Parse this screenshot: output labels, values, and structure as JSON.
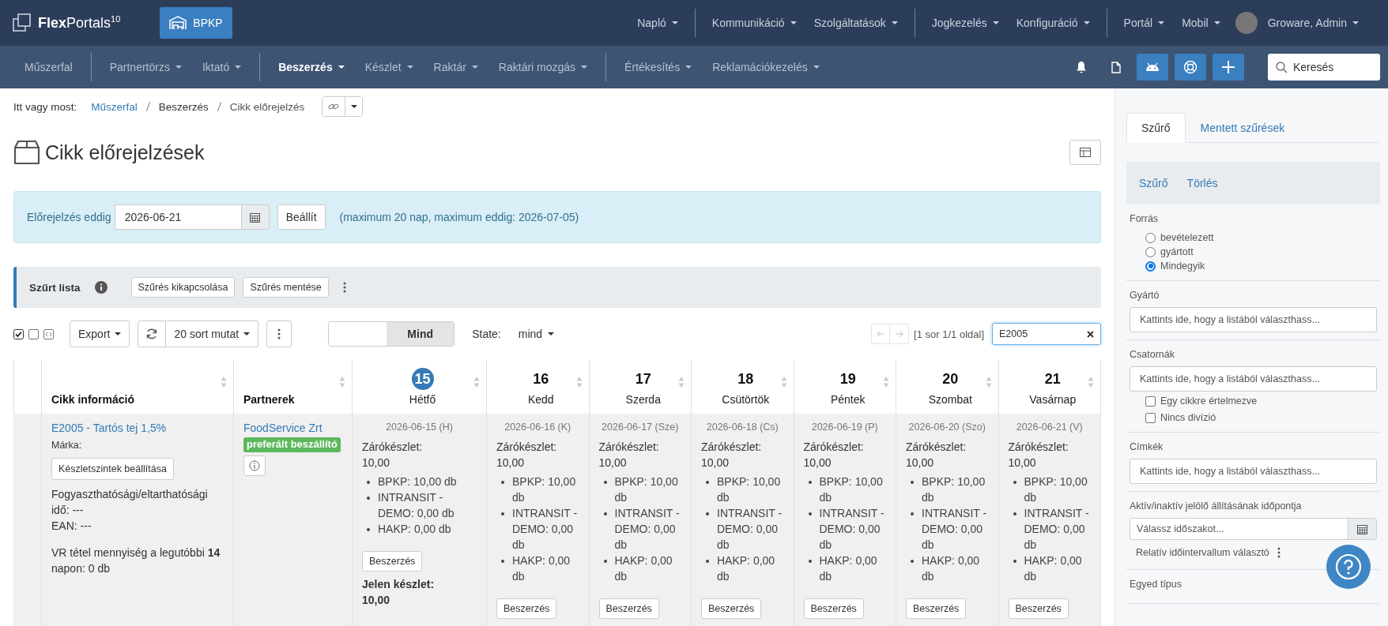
{
  "header": {
    "logo": "**Flex**Portals$^{10}$",
    "site_button": "BPKP",
    "menu_groups": [
      {
        "items": [
          {
            "label": "Napló"
          }
        ]
      },
      {
        "items": [
          {
            "label": "Kommunikáció"
          },
          {
            "label": "Szolgáltatások"
          }
        ]
      },
      {
        "items": [
          {
            "label": "Jogkezelés"
          },
          {
            "label": "Konfiguráció"
          }
        ]
      },
      {
        "items": [
          {
            "label": "Portál"
          },
          {
            "label": "Mobil"
          }
        ]
      }
    ],
    "user": "Groware, Admin"
  },
  "nav": {
    "groups": [
      {
        "items": [
          {
            "label": "Műszerfal",
            "dropdown": false,
            "selected": false
          }
        ]
      },
      {
        "items": [
          {
            "label": "Partnertörzs",
            "dropdown": true,
            "selected": false
          },
          {
            "label": "Iktató",
            "dropdown": true,
            "selected": false
          }
        ]
      },
      {
        "items": [
          {
            "label": "Beszerzés",
            "dropdown": true,
            "selected": true
          },
          {
            "label": "Készlet",
            "dropdown": true,
            "selected": false
          },
          {
            "label": "Raktár",
            "dropdown": true,
            "selected": false
          },
          {
            "label": "Raktári mozgás",
            "dropdown": true,
            "selected": false
          }
        ]
      },
      {
        "items": [
          {
            "label": "Értékesítés",
            "dropdown": true,
            "selected": false
          },
          {
            "label": "Reklamációkezelés",
            "dropdown": true,
            "selected": false
          }
        ]
      }
    ],
    "search": {
      "placeholder": "Keresés"
    }
  },
  "breadcrumb": {
    "label": "Itt vagy most:",
    "items": [
      {
        "text": "Műszerfal",
        "link": true
      },
      {
        "text": "Beszerzés",
        "link": false
      },
      {
        "text": "Cikk előrejelzés",
        "link": false
      }
    ]
  },
  "title": "Cikk előrejelzések",
  "forecast": {
    "label": "Előrejelzés eddig",
    "value": "2026-06-21",
    "button": "Beállít",
    "note": "(maximum 20 nap, maximum eddig: 2026-07-05)"
  },
  "filter_bar": {
    "title": "Szűrt lista",
    "buttons": [
      "Szűrés kikapcsolása",
      "Szűrés mentése"
    ]
  },
  "toolbar": {
    "checkboxes": [
      {
        "checked": true
      },
      {
        "checked": false
      }
    ],
    "export": "Export",
    "rows": "20 sort mutat",
    "toggle": {
      "label": "Mind",
      "on": true
    },
    "state": {
      "label": "State:",
      "value": "mind"
    },
    "pager": {
      "info": "[1 sor 1/1 oldal]",
      "prev_disabled": true,
      "next_disabled": true
    },
    "search": {
      "value": "E2005"
    }
  },
  "table": {
    "columns": [
      {
        "label": "Cikk információ"
      },
      {
        "label": "Partnerek"
      }
    ],
    "days": [
      {
        "number": "15",
        "name": "Hétfő",
        "today": true
      },
      {
        "number": "16",
        "name": "Kedd",
        "today": false
      },
      {
        "number": "17",
        "name": "Szerda",
        "today": false
      },
      {
        "number": "18",
        "name": "Csütörtök",
        "today": false
      },
      {
        "number": "19",
        "name": "Péntek",
        "today": false
      },
      {
        "number": "20",
        "name": "Szombat",
        "today": false
      },
      {
        "number": "21",
        "name": "Vasárnap",
        "today": false
      }
    ],
    "row": {
      "product": {
        "link": "E2005 - Tartós tej 1,5%",
        "brand": "Márka:",
        "button": "Készletszintek beállítása",
        "shelf_life": "Fogyaszthatósági/eltarthatósági idő: ---",
        "ean": "EAN: ---",
        "vr": "VR tétel mennyiség a legutóbbi **14** napon: 0 db"
      },
      "partner": {
        "name": "FoodService Zrt",
        "badge": "preferált beszállító"
      },
      "cells": [
        {
          "date": "2026-06-15 (H)",
          "closing_label": "Zárókészlet:",
          "closing_value": "10,00",
          "items": [
            "BPKP: 10,00 db",
            "INTRANSIT - DEMO: 0,00 db",
            "HAKP: 0,00 db"
          ],
          "button": "Beszerzés",
          "current_label": "Jelen készlet:",
          "current_value": "10,00"
        },
        {
          "date": "2026-06-16 (K)",
          "closing_label": "Zárókészlet:",
          "closing_value": "10,00",
          "items": [
            "BPKP: 10,00 db",
            "INTRANSIT - DEMO: 0,00 db",
            "HAKP: 0,00 db"
          ],
          "button": "Beszerzés"
        },
        {
          "date": "2026-06-17 (Sze)",
          "closing_label": "Zárókészlet:",
          "closing_value": "10,00",
          "items": [
            "BPKP: 10,00 db",
            "INTRANSIT - DEMO: 0,00 db",
            "HAKP: 0,00 db"
          ],
          "button": "Beszerzés"
        },
        {
          "date": "2026-06-18 (Cs)",
          "closing_label": "Zárókészlet:",
          "closing_value": "10,00",
          "items": [
            "BPKP: 10,00 db",
            "INTRANSIT - DEMO: 0,00 db",
            "HAKP: 0,00 db"
          ],
          "button": "Beszerzés"
        },
        {
          "date": "2026-06-19 (P)",
          "closing_label": "Zárókészlet:",
          "closing_value": "10,00",
          "items": [
            "BPKP: 10,00 db",
            "INTRANSIT - DEMO: 0,00 db",
            "HAKP: 0,00 db"
          ],
          "button": "Beszerzés"
        },
        {
          "date": "2026-06-20 (Szo)",
          "closing_label": "Zárókészlet:",
          "closing_value": "10,00",
          "items": [
            "BPKP: 10,00 db",
            "INTRANSIT - DEMO: 0,00 db",
            "HAKP: 0,00 db"
          ],
          "button": "Beszerzés"
        },
        {
          "date": "2026-06-21 (V)",
          "closing_label": "Zárókészlet:",
          "closing_value": "10,00",
          "items": [
            "BPKP: 10,00 db",
            "INTRANSIT - DEMO: 0,00 db",
            "HAKP: 0,00 db"
          ],
          "button": "Beszerzés"
        }
      ]
    }
  },
  "sidebar": {
    "tabs": [
      {
        "label": "Szűrő",
        "selected": true
      },
      {
        "label": "Mentett szűrések",
        "selected": false
      }
    ],
    "actions": [
      "Szűrő",
      "Törlés"
    ],
    "sections": [
      {
        "kind": "radio",
        "label": "Forrás",
        "options": [
          {
            "label": "bevételezett",
            "selected": false
          },
          {
            "label": "gyártott",
            "selected": false
          },
          {
            "label": "Mindegyik",
            "selected": true
          }
        ]
      },
      {
        "kind": "select",
        "label": "Gyártó",
        "placeholder": "Kattints ide, hogy a listából választhass..."
      },
      {
        "kind": "select",
        "label": "Csatornák",
        "placeholder": "Kattints ide, hogy a listából választhass...",
        "checkboxes": [
          {
            "label": "Egy cikkre értelmezve",
            "checked": false
          },
          {
            "label": "Nincs divízió",
            "checked": false
          }
        ]
      },
      {
        "kind": "select",
        "label": "Címkék",
        "placeholder": "Kattints ide, hogy a listából választhass..."
      },
      {
        "kind": "date",
        "label": "Aktív/inaktív jelölő állításának időpontja",
        "placeholder": "Válassz időszakot...",
        "link": "Relatív időintervallum választó"
      },
      {
        "kind": "label",
        "label": "Egyed típus"
      }
    ]
  }
}
